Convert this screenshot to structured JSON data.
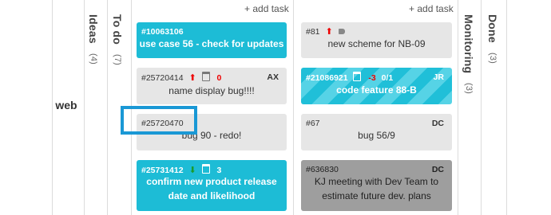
{
  "board": {
    "lane_label": "web",
    "add_task_label": "+ add task",
    "columns": [
      {
        "name": "Ideas",
        "count": "(4)"
      },
      {
        "name": "To do",
        "count": "(7)"
      },
      {
        "name": "Monitoring",
        "count": "(3)"
      },
      {
        "name": "Done",
        "count": "(3)"
      }
    ]
  },
  "todo_cards": [
    {
      "id": "#10063106",
      "title": "use case 56 - check for updates",
      "style": "teal"
    },
    {
      "id": "#25720414",
      "priority": "up",
      "date_value": "0",
      "assignee": "AX",
      "title": "name display bug!!!!",
      "style": "gray"
    },
    {
      "id": "#25720470",
      "title": "bug 90 - redo!",
      "style": "gray"
    },
    {
      "id": "#25731412",
      "priority": "down",
      "date_value": "3",
      "title_line1": "confirm new product release",
      "title_line2": "date and likelihood",
      "style": "teal"
    }
  ],
  "inprogress_cards": [
    {
      "id": "#81",
      "priority": "up",
      "tag": "tag-icon",
      "title": "new scheme for NB-09",
      "style": "gray"
    },
    {
      "id": "#21086921",
      "date_value": "-3",
      "subtasks": "0/1",
      "assignee": "JR",
      "title": "code feature 88-B",
      "style": "striped"
    },
    {
      "id": "#67",
      "assignee": "DC",
      "title": "bug 56/9",
      "style": "gray"
    },
    {
      "id": "#636830",
      "assignee": "DC",
      "title_line1": "KJ meeting with Dev Team to",
      "title_line2": "estimate future dev. plans",
      "style": "dgray"
    }
  ],
  "colors": {
    "teal": "#1dbcd6",
    "highlight": "#1a98d5",
    "priority_up": "#e00000",
    "priority_down": "#1a9c2e"
  }
}
